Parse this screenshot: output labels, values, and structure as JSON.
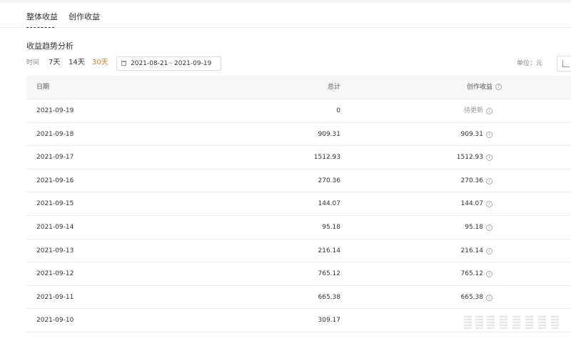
{
  "tabs": [
    {
      "label": "整体收益",
      "active": true
    },
    {
      "label": "创作收益",
      "active": false
    }
  ],
  "section": {
    "title": "收益趋势分析"
  },
  "filters": {
    "time_label": "时间",
    "ranges": [
      {
        "label": "7天",
        "active": false
      },
      {
        "label": "14天",
        "active": false
      },
      {
        "label": "30天",
        "active": true
      }
    ],
    "date_start": "2021-08-21",
    "date_separator": "~",
    "date_end": "2021-09-19",
    "unit_label": "单位：元"
  },
  "icons": {
    "calendar": "calendar-icon",
    "chart_toggle": "line-chart-icon",
    "help": "question-circle-icon",
    "info": "info-circle-icon"
  },
  "colors": {
    "accent": "#c8843a",
    "header_bg": "#f7f7f7",
    "border": "#ececec"
  },
  "table": {
    "columns": {
      "date": "日期",
      "total": "总计",
      "creative": "创作收益"
    },
    "rows": [
      {
        "date": "2021-09-19",
        "total": "0",
        "creative": "待更新",
        "pending": true
      },
      {
        "date": "2021-09-18",
        "total": "909.31",
        "creative": "909.31"
      },
      {
        "date": "2021-09-17",
        "total": "1512.93",
        "creative": "1512.93"
      },
      {
        "date": "2021-09-16",
        "total": "270.36",
        "creative": "270.36"
      },
      {
        "date": "2021-09-15",
        "total": "144.07",
        "creative": "144.07"
      },
      {
        "date": "2021-09-14",
        "total": "95.18",
        "creative": "95.18"
      },
      {
        "date": "2021-09-13",
        "total": "216.14",
        "creative": "216.14"
      },
      {
        "date": "2021-09-12",
        "total": "765.12",
        "creative": "765.12"
      },
      {
        "date": "2021-09-11",
        "total": "665.38",
        "creative": "665.38"
      },
      {
        "date": "2021-09-10",
        "total": "309.17",
        "creative": ""
      }
    ]
  }
}
